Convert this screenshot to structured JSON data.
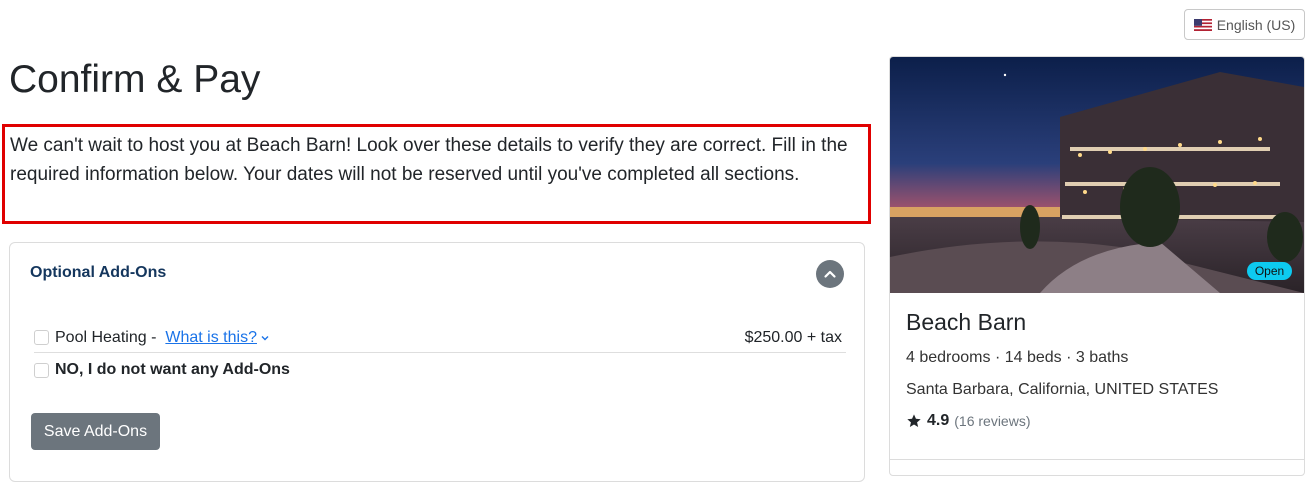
{
  "language": {
    "label": "English (US)",
    "icon": "us-flag-icon"
  },
  "page": {
    "title": "Confirm & Pay",
    "intro": "We can't wait to host you at Beach Barn! Look over these details to verify they are correct. Fill in the required information below. Your dates will not be reserved until you've completed all sections."
  },
  "addons": {
    "title": "Optional Add-Ons",
    "collapse_icon": "chevron-up-icon",
    "items": [
      {
        "label": "Pool Heating -",
        "link": "What is this?",
        "price": "$250.00 + tax",
        "checked": false
      },
      {
        "label": "NO, I do not want any Add-Ons",
        "checked": false
      }
    ],
    "save_label": "Save Add-Ons"
  },
  "property": {
    "badge": "Open",
    "name": "Beach Barn",
    "details": "4 bedrooms · 14 beds · 3 baths",
    "location": "Santa Barbara, California, UNITED STATES",
    "rating": "4.9",
    "reviews": "(16 reviews)",
    "star_icon": "star-icon"
  },
  "colors": {
    "highlight_border": "#e00000",
    "heading_navy": "#14365d",
    "link_blue": "#1a73e8",
    "button_gray": "#6c757d",
    "badge_cyan": "#0dcaf0"
  }
}
